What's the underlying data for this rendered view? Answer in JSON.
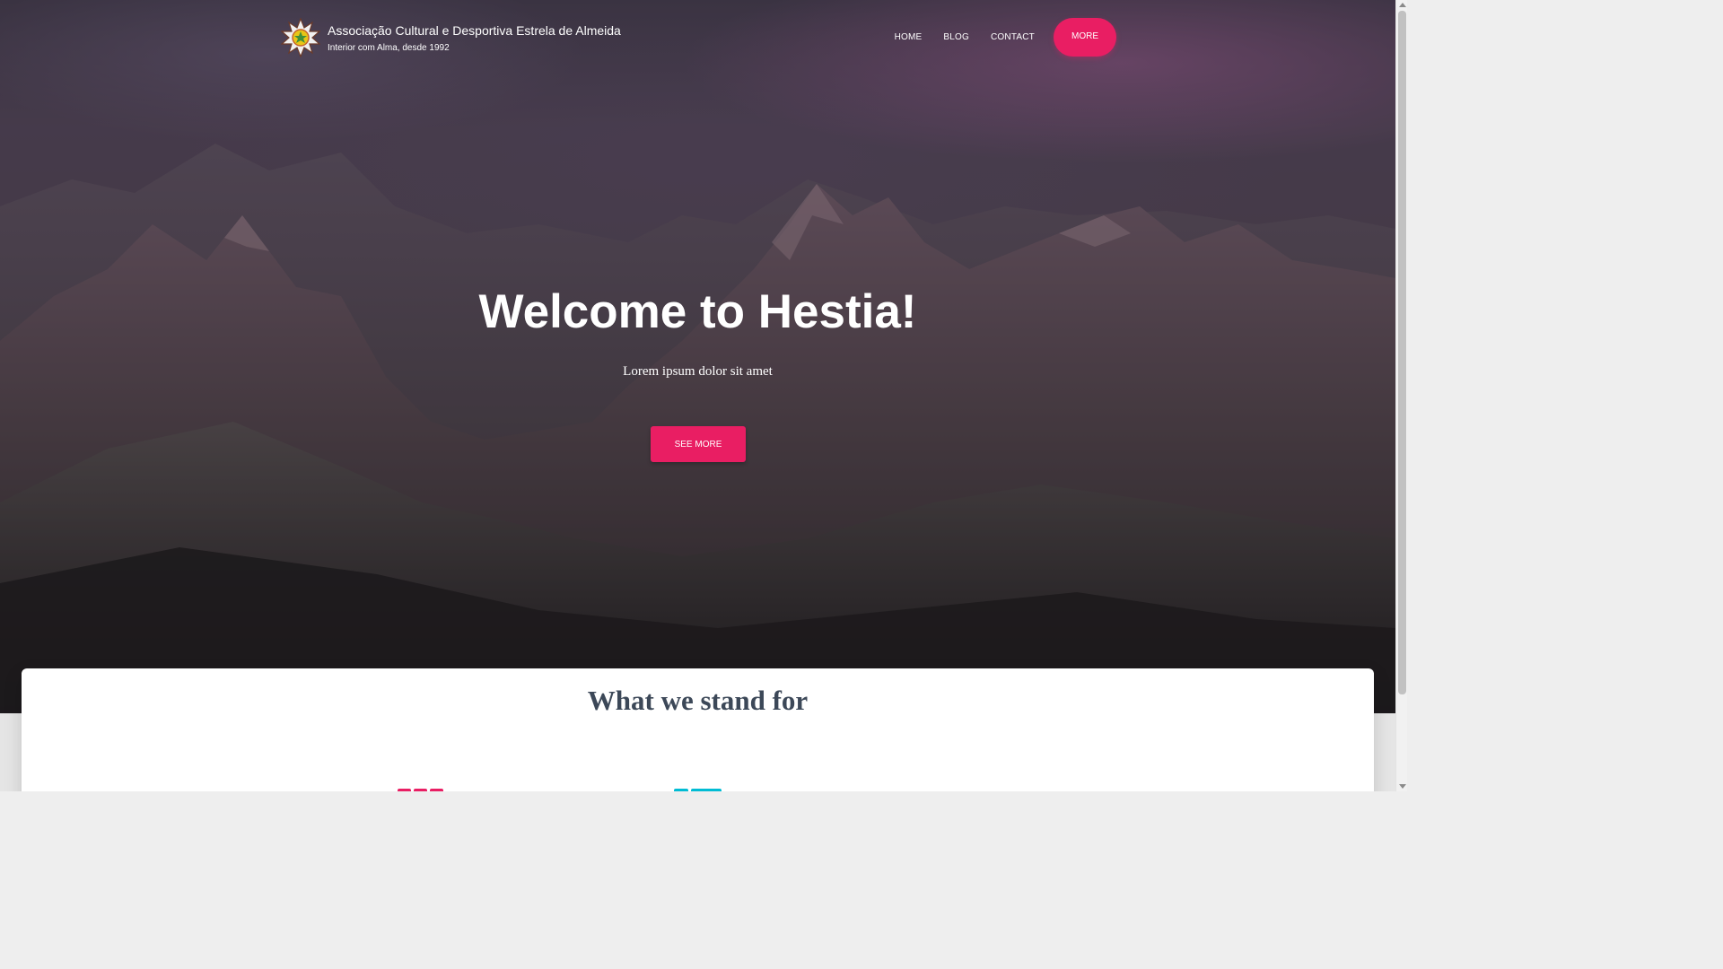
{
  "site": {
    "title": "Associação Cultural e Desportiva Estrela de Almeida",
    "tagline": "Interior com Alma, desde 1992",
    "logo_icon": "star-sun-logo-icon"
  },
  "nav": {
    "items": [
      {
        "label": "HOME"
      },
      {
        "label": "BLOG"
      },
      {
        "label": "CONTACT"
      }
    ],
    "more_label": "MORE"
  },
  "hero": {
    "title": "Welcome to Hestia!",
    "subtitle": "Lorem ipsum dolor sit amet",
    "button_label": "SEE MORE",
    "background": "mountain-range-dusk-photo"
  },
  "features": {
    "title": "What we stand for"
  },
  "colors": {
    "accent": "#e91e63",
    "secondary": "#00bcd4",
    "heading": "#3c4858"
  }
}
